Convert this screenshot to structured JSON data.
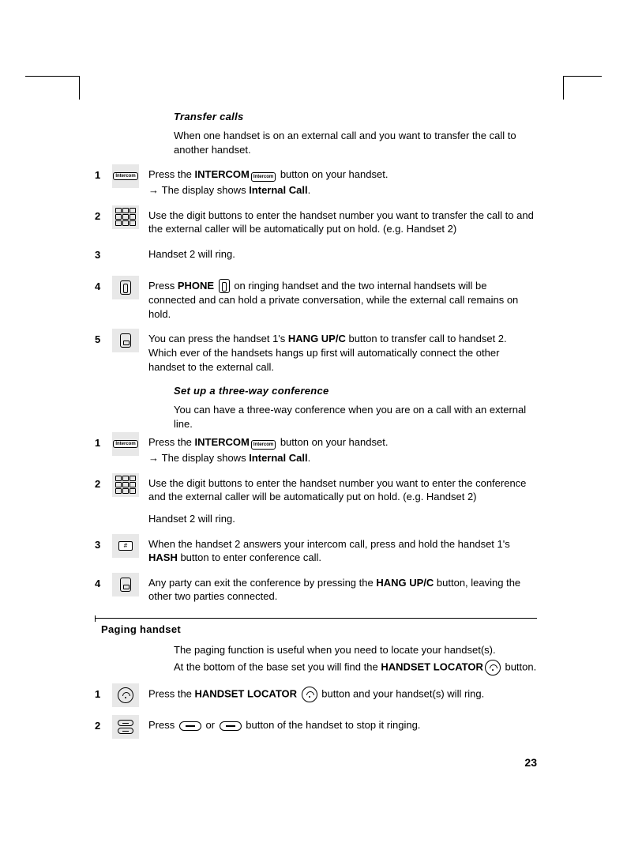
{
  "section1": {
    "title": "Transfer calls",
    "intro": "When one handset is on an external call and you want to transfer the call to another handset.",
    "steps": [
      {
        "num": "1",
        "text_pre": "Press the ",
        "bold1": "INTERCOM",
        "text_post": " button on your handset.",
        "sub_pre": "The display shows ",
        "sub_bold": "Internal Call",
        "sub_post": "."
      },
      {
        "num": "2",
        "text": "Use the digit buttons to enter the handset number you want to transfer the call to and the external caller will be automatically put on hold. (e.g. Handset 2)"
      },
      {
        "num": "3",
        "text": "Handset 2 will ring."
      },
      {
        "num": "4",
        "text_pre": "Press ",
        "bold1": "PHONE",
        "text_post": " on ringing handset and the two internal handsets will be connected and can hold a private conversation, while the external call remains on hold."
      },
      {
        "num": "5",
        "text_pre": "You can press the handset 1's ",
        "bold1": "HANG UP/C",
        "text_post": " button to transfer call to handset 2. Which ever of the handsets hangs up first will automatically connect the other handset to the external call."
      }
    ]
  },
  "section2": {
    "title": "Set up a three-way conference",
    "intro": "You can have a three-way conference when you are on a call with an external line.",
    "steps": [
      {
        "num": "1",
        "text_pre": "Press the ",
        "bold1": "INTERCOM",
        "text_post": " button on your handset.",
        "sub_pre": "The display shows ",
        "sub_bold": "Internal Call",
        "sub_post": "."
      },
      {
        "num": "2",
        "text": "Use the digit buttons to enter the handset number you want to enter the conference and the external caller will be automatically put on hold. (e.g. Handset 2)",
        "extra": "Handset 2 will ring."
      },
      {
        "num": "3",
        "text_pre": "When the handset 2 answers your intercom call, press and hold the handset 1's ",
        "bold1": "HASH",
        "text_post": " button to enter conference call."
      },
      {
        "num": "4",
        "text_pre": "Any party can exit the conference by pressing the ",
        "bold1": "HANG UP/C",
        "text_post": " button, leaving the other two parties connected."
      }
    ]
  },
  "section3": {
    "title": "Paging handset",
    "intro1": "The paging function is useful when you need to locate your handset(s).",
    "intro2_pre": "At the bottom of the base set you will find the ",
    "intro2_bold": "HANDSET LOCATOR",
    "intro2_post": " button.",
    "steps": [
      {
        "num": "1",
        "text_pre": "Press the ",
        "bold1": "HANDSET LOCATOR",
        "text_post": " button and your handset(s) will ring."
      },
      {
        "num": "2",
        "text_pre": "Press ",
        "text_mid": " or ",
        "text_post": " button of the handset to stop it ringing."
      }
    ]
  },
  "page_number": "23"
}
